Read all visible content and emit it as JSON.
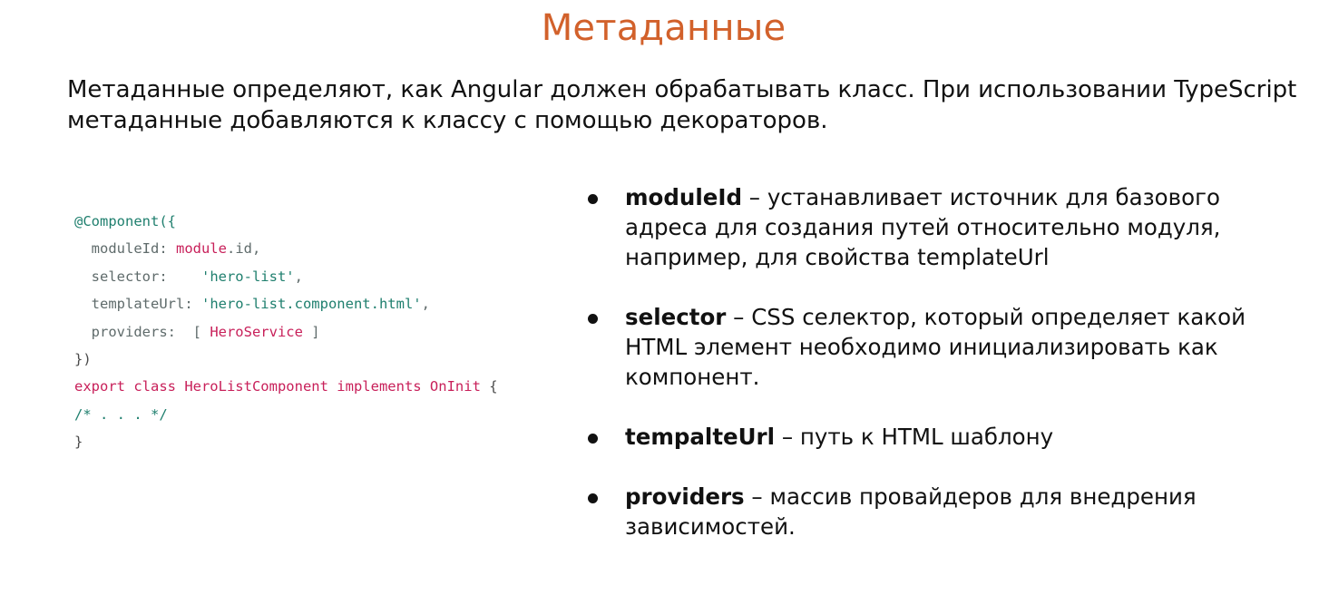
{
  "title": "Метаданные",
  "intro": {
    "line1": "Метаданные определяют, как Angular должен обрабатывать класс. При использовании TypeScript",
    "line2": "метаданные добавляются к классу с помощью декораторов."
  },
  "code": {
    "l1": "@Component({",
    "l2_key": "  moduleId: ",
    "l2_val": "module",
    "l2_rest": ".id,",
    "l3_key": "  selector:    ",
    "l3_val": "'hero-list'",
    "l3_rest": ",",
    "l4_key": "  templateUrl: ",
    "l4_val": "'hero-list.component.html'",
    "l4_rest": ",",
    "l5_key": "  providers:  [ ",
    "l5_val": "HeroService",
    "l5_rest": " ]",
    "l6": "})",
    "l7_kw": "export class HeroListComponent implements OnInit",
    "l7_rest": " {",
    "l8": "/* . . . */",
    "l9": "}"
  },
  "bullets": [
    {
      "term": "moduleId",
      "line1": " – устанавливает источник для базового",
      "line2": "адреса для создания путей относительно модуля,",
      "line3": "например, для свойства templateUrl"
    },
    {
      "term": "selector",
      "line1": " – CSS селектор, который определяет какой",
      "line2": "HTML элемент необходимо инициализировать как",
      "line3": "компонент."
    },
    {
      "term": "tempalteUrl",
      "line1": " – путь к HTML шаблону"
    },
    {
      "term": "providers",
      "line1": " – массив провайдеров для внедрения",
      "line2": "зависимостей."
    }
  ],
  "colors": {
    "title": "#d2612b",
    "code_decorator": "#1f7f6e",
    "code_keyword": "#c8205a"
  }
}
